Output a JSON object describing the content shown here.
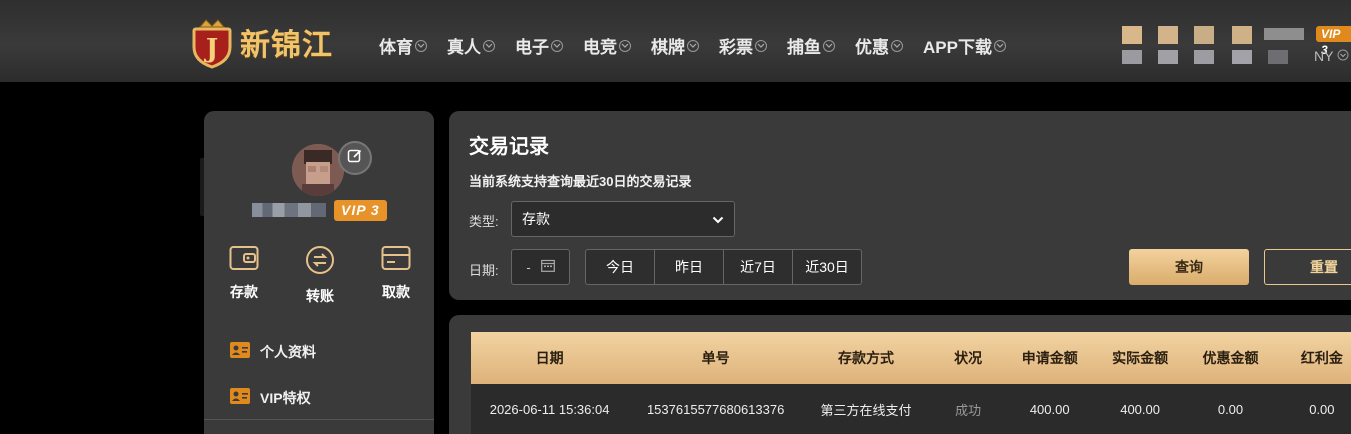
{
  "brand": {
    "name": "新锦江",
    "logo_letter": "J"
  },
  "nav": [
    {
      "label": "体育"
    },
    {
      "label": "真人"
    },
    {
      "label": "电子"
    },
    {
      "label": "电竞"
    },
    {
      "label": "棋牌"
    },
    {
      "label": "彩票"
    },
    {
      "label": "捕鱼"
    },
    {
      "label": "优惠"
    },
    {
      "label": "APP下载"
    }
  ],
  "header_user": {
    "vip_label": "VIP 3",
    "currency_suffix": "NY"
  },
  "sidebar": {
    "vip_label": "VIP 3",
    "actions": [
      {
        "label": "存款",
        "icon": "wallet-icon"
      },
      {
        "label": "转账",
        "icon": "transfer-icon"
      },
      {
        "label": "取款",
        "icon": "card-icon"
      }
    ],
    "menu": [
      {
        "label": "个人资料",
        "icon": "id-card-icon"
      },
      {
        "label": "VIP特权",
        "icon": "id-card-icon"
      }
    ]
  },
  "records": {
    "title": "交易记录",
    "subtitle": "当前系统支持查询最近30日的交易记录",
    "type_label": "类型:",
    "type_value": "存款",
    "date_label": "日期:",
    "date_value": "-",
    "ranges": [
      "今日",
      "昨日",
      "近7日",
      "近30日"
    ],
    "query_label": "查询",
    "reset_label": "重置"
  },
  "table": {
    "columns": [
      "日期",
      "单号",
      "存款方式",
      "状况",
      "申请金额",
      "实际金额",
      "优惠金额",
      "红利金"
    ],
    "rows": [
      [
        "2026-06-11 15:36:04",
        "1537615577680613376",
        "第三方在线支付",
        "成功",
        "400.00",
        "400.00",
        "0.00",
        "0.00"
      ]
    ]
  },
  "colors": {
    "accent_gold": "#e6c18a",
    "vip_orange": "#e8922a",
    "panel_bg": "#3a3a3a"
  }
}
